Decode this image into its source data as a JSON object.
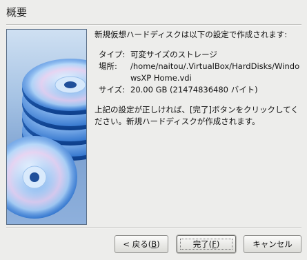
{
  "header": {
    "title": "概要"
  },
  "content": {
    "intro": "新規仮想ハードディスクは以下の設定で作成されます:",
    "type_label": "タイプ:",
    "type_value": "可変サイズのストレージ",
    "location_label": "場所:",
    "location_value": "/home/naitou/.VirtualBox/HardDisks/WindowsXP Home.vdi",
    "size_label": "サイズ:",
    "size_value": "20.00 GB (21474836480 バイト)",
    "note": "上記の設定が正しければ、[完了]ボタンをクリックしてください。新規ハードディスクが作成されます。"
  },
  "buttons": {
    "back_prefix": "< 戻る(",
    "back_key": "B",
    "back_suffix": ")",
    "finish_prefix": "完了(",
    "finish_key": "F",
    "finish_suffix": ")",
    "cancel": "キャンセル"
  },
  "colors": {
    "accent_disc": "#1f6ed1",
    "border": "#5a6e86"
  }
}
